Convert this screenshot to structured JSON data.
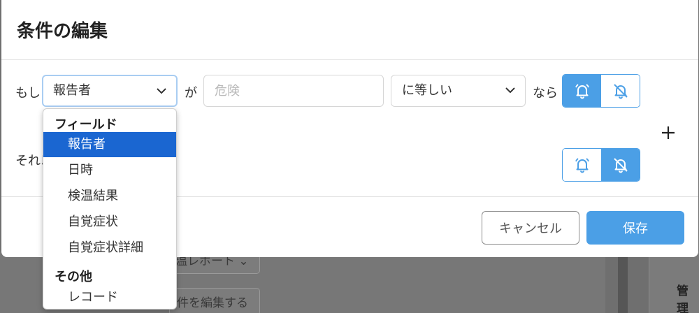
{
  "dialog": {
    "title": "条件の編集",
    "row1": {
      "if_label": "もし",
      "field_value": "報告者",
      "particle": "が",
      "value_placeholder": "危険",
      "operator_value": "に等しい",
      "then_label": "なら",
      "toggle_selected": "bell"
    },
    "row2": {
      "else_label": "それ以",
      "toggle_selected": "bell-off"
    },
    "buttons": {
      "cancel": "キャンセル",
      "save": "保存"
    }
  },
  "dropdown": {
    "groups": [
      {
        "label": "フィールド"
      },
      {
        "label": "その他"
      }
    ],
    "items": [
      "報告者",
      "日時",
      "検温結果",
      "自覚症状",
      "自覚症状詳細",
      "レコード"
    ],
    "selected": "報告者"
  },
  "background": {
    "button1": "温レポート",
    "button2": "件を編集する",
    "side_label": "管理"
  },
  "colors": {
    "accent": "#4b9fe6",
    "dropdown_selected": "#1a66d1",
    "focus_border": "#a9cdf2"
  },
  "icons": {
    "bell": "bell-icon",
    "bell_off": "bell-off-icon",
    "chevron": "chevron-down-icon",
    "add": "plus-icon"
  }
}
